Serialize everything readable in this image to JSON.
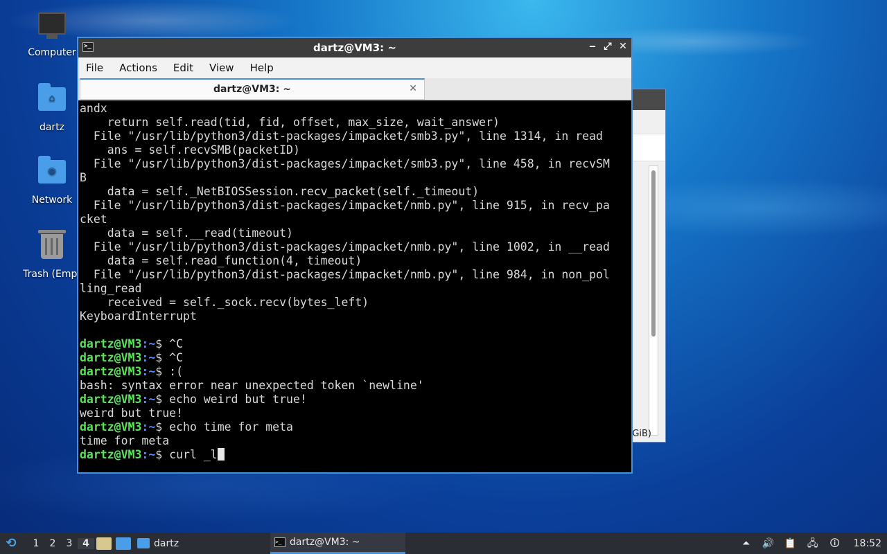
{
  "desktop": {
    "icons": [
      {
        "label": "Computer"
      },
      {
        "label": "dartz"
      },
      {
        "label": "Network"
      },
      {
        "label": "Trash (Empt"
      }
    ]
  },
  "background_window": {
    "partial_text": "GiB)"
  },
  "terminal": {
    "title": "dartz@VM3: ~",
    "menu": [
      "File",
      "Actions",
      "Edit",
      "View",
      "Help"
    ],
    "tab_label": "dartz@VM3: ~",
    "prompt_user": "dartz@VM3",
    "prompt_path": ":~",
    "prompt_symbol": "$",
    "output_lines": [
      "andx",
      "    return self.read(tid, fid, offset, max_size, wait_answer)",
      "  File \"/usr/lib/python3/dist-packages/impacket/smb3.py\", line 1314, in read",
      "    ans = self.recvSMB(packetID)",
      "  File \"/usr/lib/python3/dist-packages/impacket/smb3.py\", line 458, in recvSM",
      "B",
      "    data = self._NetBIOSSession.recv_packet(self._timeout)",
      "  File \"/usr/lib/python3/dist-packages/impacket/nmb.py\", line 915, in recv_pa",
      "cket",
      "    data = self.__read(timeout)",
      "  File \"/usr/lib/python3/dist-packages/impacket/nmb.py\", line 1002, in __read",
      "    data = self.read_function(4, timeout)",
      "  File \"/usr/lib/python3/dist-packages/impacket/nmb.py\", line 984, in non_pol",
      "ling_read",
      "    received = self._sock.recv(bytes_left)",
      "KeyboardInterrupt",
      ""
    ],
    "session": [
      {
        "cmd": " ^C"
      },
      {
        "cmd": " ^C"
      },
      {
        "cmd": " :(",
        "out": "bash: syntax error near unexpected token `newline'"
      },
      {
        "cmd": " echo weird but true!",
        "out": "weird but true!"
      },
      {
        "cmd": " echo time for meta",
        "out": "time for meta"
      }
    ],
    "current_input": " curl _l"
  },
  "taskbar": {
    "workspaces": [
      "1",
      "2",
      "3",
      "4"
    ],
    "active_workspace": "4",
    "tasks": [
      {
        "label": "dartz",
        "icon": "folder-icon"
      },
      {
        "label": "dartz@VM3: ~",
        "icon": "terminal-icon"
      }
    ],
    "clock": "18:52"
  },
  "colors": {
    "prompt_user": "#5be35b",
    "prompt_path": "#5b8bff",
    "accent": "#4a8fd6"
  }
}
